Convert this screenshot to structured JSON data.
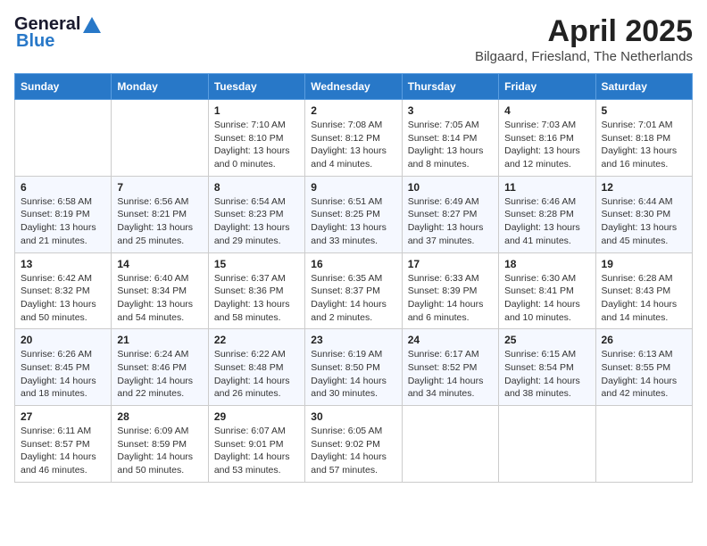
{
  "header": {
    "logo_general": "General",
    "logo_blue": "Blue",
    "title": "April 2025",
    "subtitle": "Bilgaard, Friesland, The Netherlands"
  },
  "calendar": {
    "days_of_week": [
      "Sunday",
      "Monday",
      "Tuesday",
      "Wednesday",
      "Thursday",
      "Friday",
      "Saturday"
    ],
    "weeks": [
      [
        {
          "day": "",
          "info": ""
        },
        {
          "day": "",
          "info": ""
        },
        {
          "day": "1",
          "info": "Sunrise: 7:10 AM\nSunset: 8:10 PM\nDaylight: 13 hours and 0 minutes."
        },
        {
          "day": "2",
          "info": "Sunrise: 7:08 AM\nSunset: 8:12 PM\nDaylight: 13 hours and 4 minutes."
        },
        {
          "day": "3",
          "info": "Sunrise: 7:05 AM\nSunset: 8:14 PM\nDaylight: 13 hours and 8 minutes."
        },
        {
          "day": "4",
          "info": "Sunrise: 7:03 AM\nSunset: 8:16 PM\nDaylight: 13 hours and 12 minutes."
        },
        {
          "day": "5",
          "info": "Sunrise: 7:01 AM\nSunset: 8:18 PM\nDaylight: 13 hours and 16 minutes."
        }
      ],
      [
        {
          "day": "6",
          "info": "Sunrise: 6:58 AM\nSunset: 8:19 PM\nDaylight: 13 hours and 21 minutes."
        },
        {
          "day": "7",
          "info": "Sunrise: 6:56 AM\nSunset: 8:21 PM\nDaylight: 13 hours and 25 minutes."
        },
        {
          "day": "8",
          "info": "Sunrise: 6:54 AM\nSunset: 8:23 PM\nDaylight: 13 hours and 29 minutes."
        },
        {
          "day": "9",
          "info": "Sunrise: 6:51 AM\nSunset: 8:25 PM\nDaylight: 13 hours and 33 minutes."
        },
        {
          "day": "10",
          "info": "Sunrise: 6:49 AM\nSunset: 8:27 PM\nDaylight: 13 hours and 37 minutes."
        },
        {
          "day": "11",
          "info": "Sunrise: 6:46 AM\nSunset: 8:28 PM\nDaylight: 13 hours and 41 minutes."
        },
        {
          "day": "12",
          "info": "Sunrise: 6:44 AM\nSunset: 8:30 PM\nDaylight: 13 hours and 45 minutes."
        }
      ],
      [
        {
          "day": "13",
          "info": "Sunrise: 6:42 AM\nSunset: 8:32 PM\nDaylight: 13 hours and 50 minutes."
        },
        {
          "day": "14",
          "info": "Sunrise: 6:40 AM\nSunset: 8:34 PM\nDaylight: 13 hours and 54 minutes."
        },
        {
          "day": "15",
          "info": "Sunrise: 6:37 AM\nSunset: 8:36 PM\nDaylight: 13 hours and 58 minutes."
        },
        {
          "day": "16",
          "info": "Sunrise: 6:35 AM\nSunset: 8:37 PM\nDaylight: 14 hours and 2 minutes."
        },
        {
          "day": "17",
          "info": "Sunrise: 6:33 AM\nSunset: 8:39 PM\nDaylight: 14 hours and 6 minutes."
        },
        {
          "day": "18",
          "info": "Sunrise: 6:30 AM\nSunset: 8:41 PM\nDaylight: 14 hours and 10 minutes."
        },
        {
          "day": "19",
          "info": "Sunrise: 6:28 AM\nSunset: 8:43 PM\nDaylight: 14 hours and 14 minutes."
        }
      ],
      [
        {
          "day": "20",
          "info": "Sunrise: 6:26 AM\nSunset: 8:45 PM\nDaylight: 14 hours and 18 minutes."
        },
        {
          "day": "21",
          "info": "Sunrise: 6:24 AM\nSunset: 8:46 PM\nDaylight: 14 hours and 22 minutes."
        },
        {
          "day": "22",
          "info": "Sunrise: 6:22 AM\nSunset: 8:48 PM\nDaylight: 14 hours and 26 minutes."
        },
        {
          "day": "23",
          "info": "Sunrise: 6:19 AM\nSunset: 8:50 PM\nDaylight: 14 hours and 30 minutes."
        },
        {
          "day": "24",
          "info": "Sunrise: 6:17 AM\nSunset: 8:52 PM\nDaylight: 14 hours and 34 minutes."
        },
        {
          "day": "25",
          "info": "Sunrise: 6:15 AM\nSunset: 8:54 PM\nDaylight: 14 hours and 38 minutes."
        },
        {
          "day": "26",
          "info": "Sunrise: 6:13 AM\nSunset: 8:55 PM\nDaylight: 14 hours and 42 minutes."
        }
      ],
      [
        {
          "day": "27",
          "info": "Sunrise: 6:11 AM\nSunset: 8:57 PM\nDaylight: 14 hours and 46 minutes."
        },
        {
          "day": "28",
          "info": "Sunrise: 6:09 AM\nSunset: 8:59 PM\nDaylight: 14 hours and 50 minutes."
        },
        {
          "day": "29",
          "info": "Sunrise: 6:07 AM\nSunset: 9:01 PM\nDaylight: 14 hours and 53 minutes."
        },
        {
          "day": "30",
          "info": "Sunrise: 6:05 AM\nSunset: 9:02 PM\nDaylight: 14 hours and 57 minutes."
        },
        {
          "day": "",
          "info": ""
        },
        {
          "day": "",
          "info": ""
        },
        {
          "day": "",
          "info": ""
        }
      ]
    ]
  }
}
